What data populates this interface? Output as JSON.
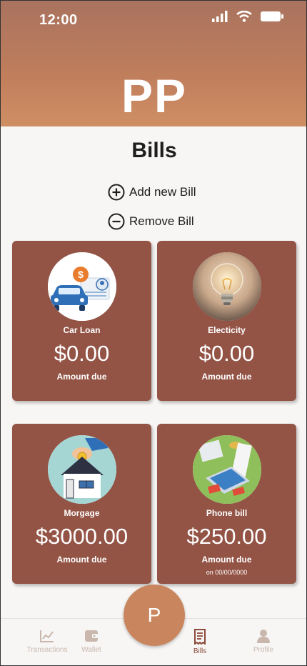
{
  "status_bar": {
    "time": "12:00"
  },
  "header": {
    "logo": "PP"
  },
  "page": {
    "title": "Bills"
  },
  "actions": {
    "add_label": "Add new Bill",
    "remove_label": "Remove Bill"
  },
  "bills": [
    {
      "name": "Car Loan",
      "amount": "$0.00",
      "sub": "Amount due",
      "date": ""
    },
    {
      "name": "Electicity",
      "amount": "$0.00",
      "sub": "Amount due",
      "date": ""
    },
    {
      "name": "Morgage",
      "amount": "$3000.00",
      "sub": "Amount due",
      "date": ""
    },
    {
      "name": "Phone bill",
      "amount": "$250.00",
      "sub": "Amount due",
      "date": "on 00/00/0000"
    }
  ],
  "tabbar": {
    "transactions": "Transactions",
    "wallet": "Wallet",
    "bills": "Bills",
    "profile": "Profile",
    "center_button": "P"
  },
  "colors": {
    "header_gradient_top": "#a9735f",
    "header_gradient_bottom": "#cf8f65",
    "card": "#935446",
    "accent": "#c9865e",
    "tab_active": "#8b4a3a",
    "tab_inactive": "#c9b7ae"
  },
  "icons": {
    "status": [
      "signal-icon",
      "wifi-icon",
      "battery-icon"
    ],
    "actions": [
      "plus-circle-icon",
      "minus-circle-icon"
    ],
    "tabs": [
      "chart-icon",
      "wallet-icon",
      "receipt-icon",
      "person-icon"
    ]
  }
}
